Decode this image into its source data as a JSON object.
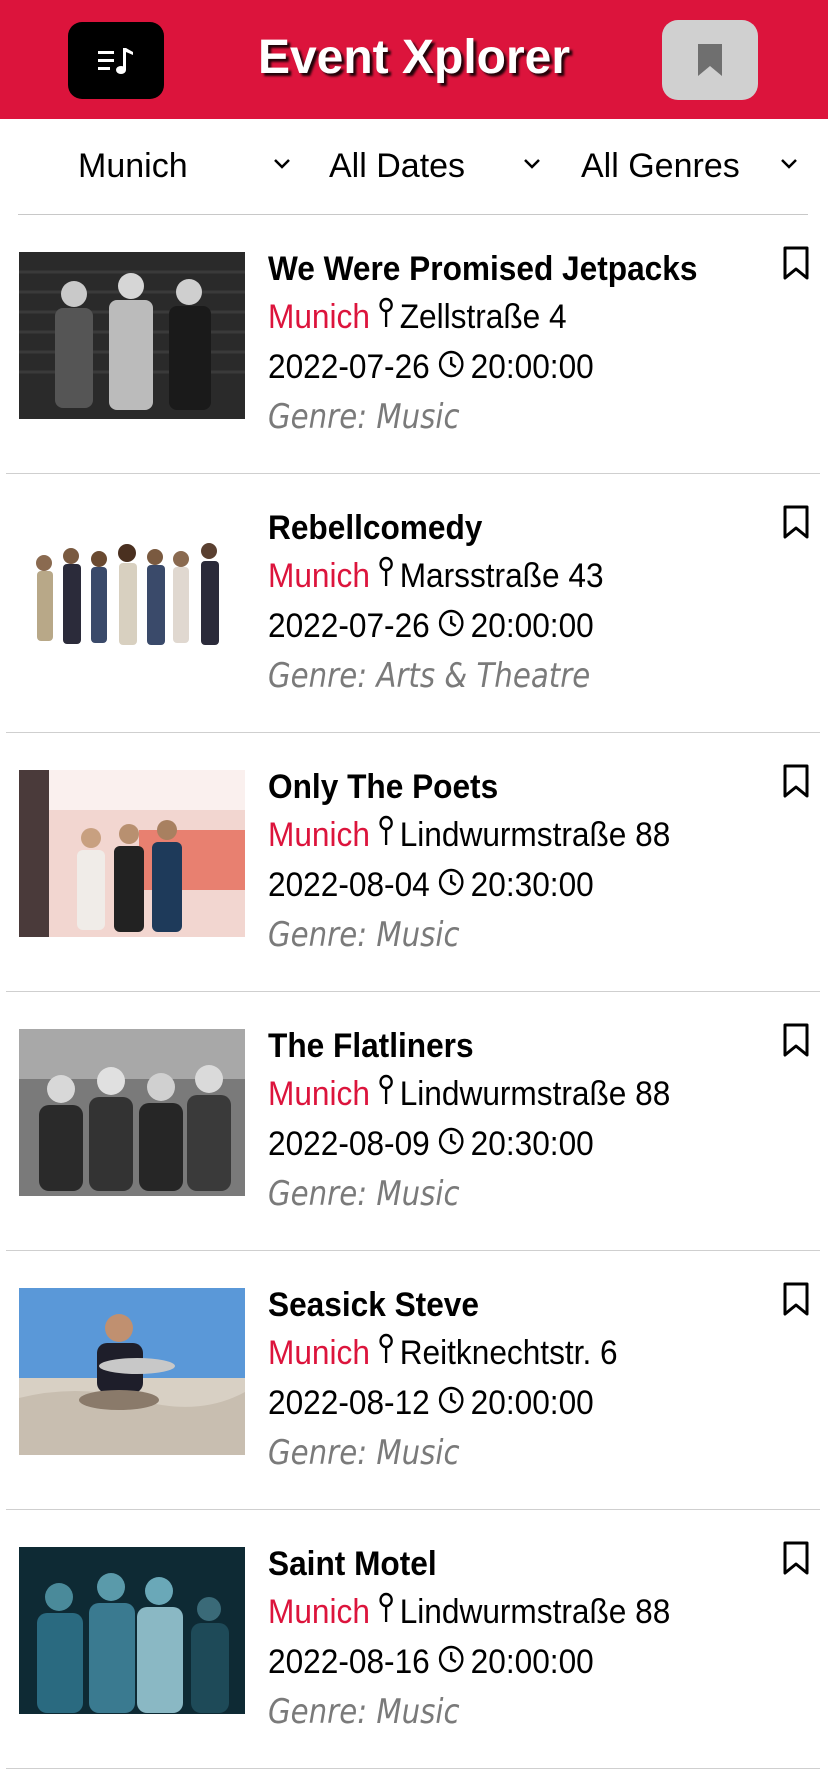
{
  "header": {
    "title": "Event Xplorer",
    "menu_icon": "music-list-icon",
    "bookmark_icon": "bookmark-icon",
    "brand_color": "#dc143c"
  },
  "filters": {
    "city": "Munich",
    "dates": "All Dates",
    "genres": "All Genres"
  },
  "events": [
    {
      "name": "We Were Promised Jetpacks",
      "city": "Munich",
      "address": "Zellstraße 4",
      "date": "2022-07-26",
      "time": "20:00:00",
      "genre": "Genre: Music"
    },
    {
      "name": "Rebellcomedy",
      "city": "Munich",
      "address": "Marsstraße 43",
      "date": "2022-07-26",
      "time": "20:00:00",
      "genre": "Genre: Arts & Theatre"
    },
    {
      "name": "Only The Poets",
      "city": "Munich",
      "address": "Lindwurmstraße 88",
      "date": "2022-08-04",
      "time": "20:30:00",
      "genre": "Genre: Music"
    },
    {
      "name": "The Flatliners",
      "city": "Munich",
      "address": "Lindwurmstraße 88",
      "date": "2022-08-09",
      "time": "20:30:00",
      "genre": "Genre: Music"
    },
    {
      "name": "Seasick Steve",
      "city": "Munich",
      "address": "Reitknechtstr. 6",
      "date": "2022-08-12",
      "time": "20:00:00",
      "genre": "Genre: Music"
    },
    {
      "name": "Saint Motel",
      "city": "Munich",
      "address": "Lindwurmstraße 88",
      "date": "2022-08-16",
      "time": "20:00:00",
      "genre": "Genre: Music"
    }
  ]
}
